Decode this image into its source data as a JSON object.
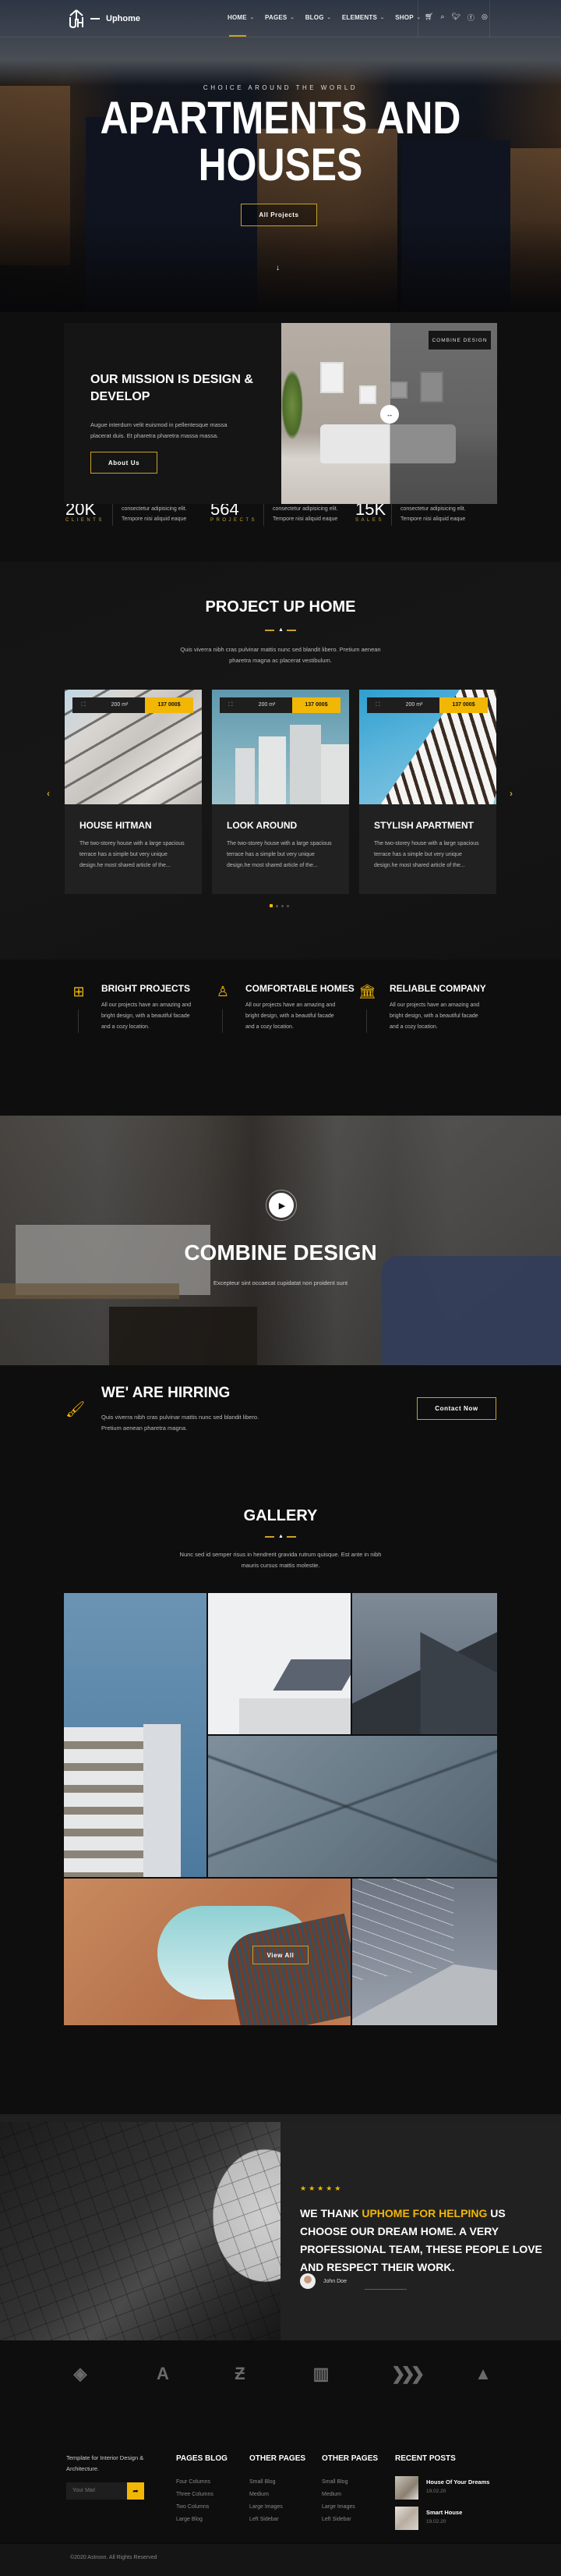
{
  "nav": {
    "brand": "Uphome",
    "items": [
      {
        "label": "HOME",
        "active": true
      },
      {
        "label": "PAGES"
      },
      {
        "label": "BLOG"
      },
      {
        "label": "ELEMENTS"
      },
      {
        "label": "SHOP"
      }
    ],
    "icons": [
      "cart-icon",
      "search-icon",
      "twitter-icon",
      "facebook-icon",
      "instagram-icon"
    ]
  },
  "hero": {
    "eyebrow": "CHOICE AROUND THE WORLD",
    "title_line1": "APARTMENTS AND",
    "title_line2": "HOUSES",
    "button": "All Projects"
  },
  "mission": {
    "title_line1": "OUR MISSION IS DESIGN &",
    "title_line2": "DEVELOP",
    "text": "Augue interdum velit euismod in pellentesque massa placerat duis. Et pharetra pharetra massa massa.",
    "button": "About Us",
    "compare_badge": "COMBINE DESIGN"
  },
  "stats": [
    {
      "value": "20K",
      "label": "CLIENTS",
      "desc1": "consectetur adipisicing elit.",
      "desc2": "Tempore nisi aliquid eaque"
    },
    {
      "value": "564",
      "label": "PROJECTS",
      "desc1": "consectetur adipisicing elit.",
      "desc2": "Tempore nisi aliquid eaque"
    },
    {
      "value": "15K",
      "label": "SALES",
      "desc1": "consectetur adipisicing elit.",
      "desc2": "Tempore nisi aliquid eaque"
    }
  ],
  "projects": {
    "title": "PROJECT UP HOME",
    "subtitle_line1": "Quis viverra nibh cras pulvinar mattis nunc sed blandit libero. Pretium aenean",
    "subtitle_line2": "pharetra magna ac placerat vestibulum.",
    "cards": [
      {
        "area": "200 m²",
        "price": "137 000$",
        "title": "HOUSE HITMAN",
        "text": "The two-storey house with a large spacious terrace has a simple but very unique design.he most shared article of the..."
      },
      {
        "area": "200 m²",
        "price": "137 000$",
        "title": "LOOK AROUND",
        "text": "The two-storey house with a large spacious terrace has a simple but very unique design.he most shared article of the..."
      },
      {
        "area": "200 m²",
        "price": "137 000$",
        "title": "STYLISH APARTMENT",
        "text": "The two-storey house with a large spacious terrace has a simple but very unique design.he most shared article of the..."
      }
    ],
    "slider_total": 4,
    "slider_active": 1
  },
  "features": [
    {
      "icon": "window-icon",
      "title": "BRIGHT PROJECTS",
      "text": "All our projects have an amazing and bright design, with a beautiful facade and a cozy location."
    },
    {
      "icon": "office-chair-icon",
      "title": "COMFORTABLE HOMES",
      "text": "All our projects have an amazing and bright design, with a beautiful facade and a cozy location."
    },
    {
      "icon": "column-icon",
      "title": "RELIABLE COMPANY",
      "text": "All our projects have an amazing and bright design, with a beautiful facade and a cozy location."
    }
  ],
  "video": {
    "title": "COMBINE DESIGN",
    "subtitle": "Excepteur sint occaecat cupidatat non proident sunt"
  },
  "hiring": {
    "title": "WE' ARE HIRRING",
    "text_line1": "Quis viverra nibh cras pulvinar mattis nunc sed blandit libero.",
    "text_line2": "Pretium aenean pharetra magna.",
    "button": "Contact Now"
  },
  "gallery": {
    "title": "GALLERY",
    "subtitle_line1": "Nunc sed id semper risus in hendrerit gravida rutrum quisque. Est ante in nibh",
    "subtitle_line2": "mauris cursus mattis molestie.",
    "button": "View All"
  },
  "testimonial": {
    "rating": 5,
    "stars": "★★★★★",
    "quote_pre": "WE THANK ",
    "quote_highlight": "UPHOME FOR HELPING",
    "quote_post": " US CHOOSE OUR DREAM HOME. A VERY PROFESSIONAL TEAM, THESE PEOPLE LOVE AND RESPECT THEIR WORK.",
    "author": "John Doe"
  },
  "partners": [
    "diamond-logo",
    "letter-a-logo",
    "letter-z-logo",
    "bars-logo",
    "chevrons-logo",
    "triforce-logo"
  ],
  "footer": {
    "about": "Template for Interior Design & Architecture.",
    "mail_placeholder": "Your Mail",
    "col1": {
      "title": "PAGES BLOG",
      "links": [
        "Four Columns",
        "Three Columns",
        "Two Columns",
        "Large Blog"
      ]
    },
    "col2": {
      "title": "OTHER PAGES",
      "links": [
        "Small Blog",
        "Medium",
        "Large Images",
        "Left Sidebar"
      ]
    },
    "col3": {
      "title": "OTHER PAGES",
      "links": [
        "Small Blog",
        "Medium",
        "Large Images",
        "Left Sidebar"
      ]
    },
    "recent": {
      "title": "RECENT POSTS",
      "posts": [
        {
          "title": "House Of Your Dreams",
          "date": "19.02.20"
        },
        {
          "title": "Smart House",
          "date": "19.02.20"
        }
      ]
    },
    "copyright": "©2020 Astroon. All Rights Reserved"
  },
  "colors": {
    "accent": "#f2b705",
    "accent_border": "#c9a227",
    "background": "#0e0e0e",
    "card": "#212121"
  }
}
